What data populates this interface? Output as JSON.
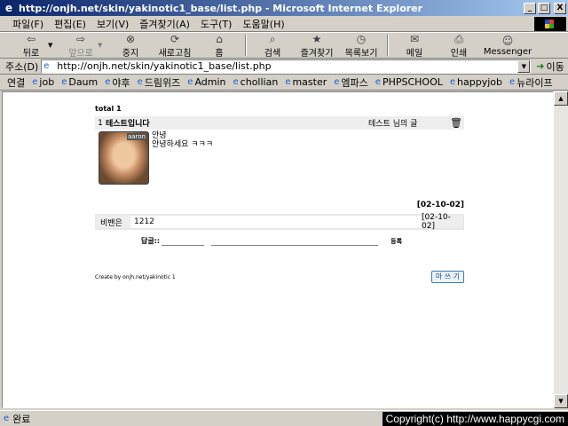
{
  "window": {
    "title": "http://onjh.net/skin/yakinotic1_base/list.php - Microsoft Internet Explorer",
    "buttons": [
      "_",
      "□",
      "X"
    ]
  },
  "menu": [
    "파일(F)",
    "편집(E)",
    "보기(V)",
    "즐겨찾기(A)",
    "도구(T)",
    "도움말(H)"
  ],
  "toolbar": [
    {
      "label": "뒤로",
      "icon": "back-arrow-icon",
      "glyph": "⇦",
      "enabled": true,
      "dropdown": true
    },
    {
      "label": "앞으로",
      "icon": "forward-arrow-icon",
      "glyph": "⇨",
      "enabled": false,
      "dropdown": true
    },
    {
      "label": "중지",
      "icon": "stop-icon",
      "glyph": "⊗",
      "enabled": true
    },
    {
      "label": "새로고침",
      "icon": "refresh-icon",
      "glyph": "⟳",
      "enabled": true
    },
    {
      "label": "홈",
      "icon": "home-icon",
      "glyph": "⌂",
      "enabled": true
    },
    {
      "label": "검색",
      "icon": "search-icon",
      "glyph": "⌕",
      "enabled": true
    },
    {
      "label": "즐겨찾기",
      "icon": "favorites-icon",
      "glyph": "★",
      "enabled": true
    },
    {
      "label": "목록보기",
      "icon": "history-icon",
      "glyph": "◷",
      "enabled": true
    },
    {
      "label": "메일",
      "icon": "mail-icon",
      "glyph": "✉",
      "enabled": true,
      "dropdown": true
    },
    {
      "label": "인쇄",
      "icon": "print-icon",
      "glyph": "⎙",
      "enabled": true
    },
    {
      "label": "Messenger",
      "icon": "messenger-icon",
      "glyph": "☺",
      "enabled": true
    }
  ],
  "address": {
    "label": "주소(D)",
    "url": "http://onjh.net/skin/yakinotic1_base/list.php",
    "go_label": "이동"
  },
  "links": {
    "label": "연결",
    "items": [
      "job",
      "Daum",
      "야후",
      "드림위즈",
      "Admin",
      "chollian",
      "master",
      "엠파스",
      "PHPSCHOOL",
      "happyjob",
      "뉴라이프"
    ]
  },
  "board": {
    "total_label": "total 1",
    "post": {
      "number": "1",
      "title": "테스트입니다",
      "author": "테스트 님의 글",
      "avatar_tag": "aaron",
      "body_lines": [
        "안녕",
        "안녕하세요 ㅋㅋㅋ"
      ],
      "date": "[02-10-02]"
    },
    "comment": {
      "name": "비밴은",
      "text": "1212",
      "date": "[02-10-02]"
    },
    "reply": {
      "label": "답글::",
      "submit": "등록"
    },
    "credit": "Create by onjh.net/yakinotic 1",
    "write_button": "마 쓰 기"
  },
  "status": {
    "text": "완료",
    "copyright": "Copyright(c) http://www.happycgi.com"
  }
}
